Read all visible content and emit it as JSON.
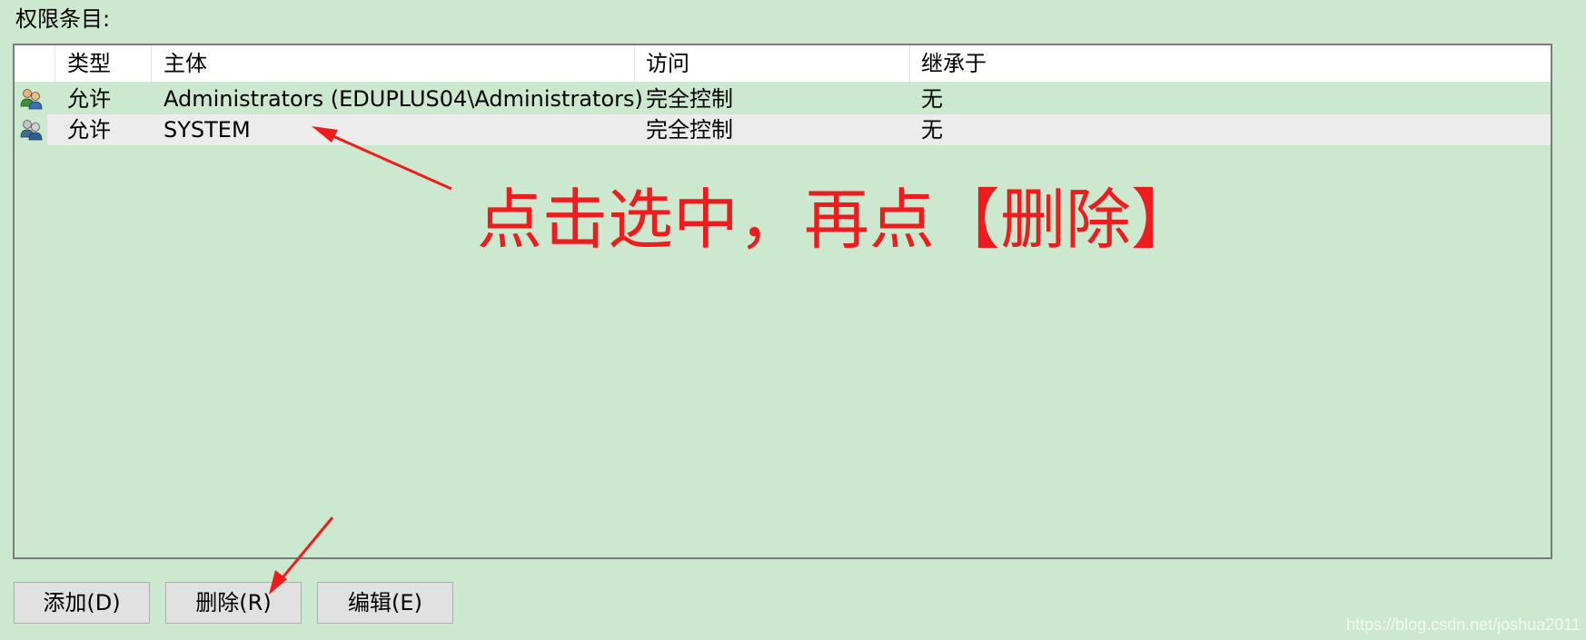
{
  "section_label": "权限条目:",
  "columns": [
    "类型",
    "主体",
    "访问",
    "继承于"
  ],
  "rows": [
    {
      "type": "允许",
      "principal": "Administrators (EDUPLUS04\\Administrators)",
      "access": "完全控制",
      "inherited_from": "无",
      "icon": "user-group-icon"
    },
    {
      "type": "允许",
      "principal": "SYSTEM",
      "access": "完全控制",
      "inherited_from": "无",
      "icon": "user-group-icon"
    }
  ],
  "buttons": {
    "add": "添加(D)",
    "remove": "删除(R)",
    "edit": "编辑(E)"
  },
  "annotation": "点击选中，再点【删除】",
  "watermark": "https://blog.csdn.net/joshua2011",
  "colors": {
    "background": "#cce8cf",
    "annotation": "#ee1c1c",
    "selected_row": "#ececec"
  }
}
